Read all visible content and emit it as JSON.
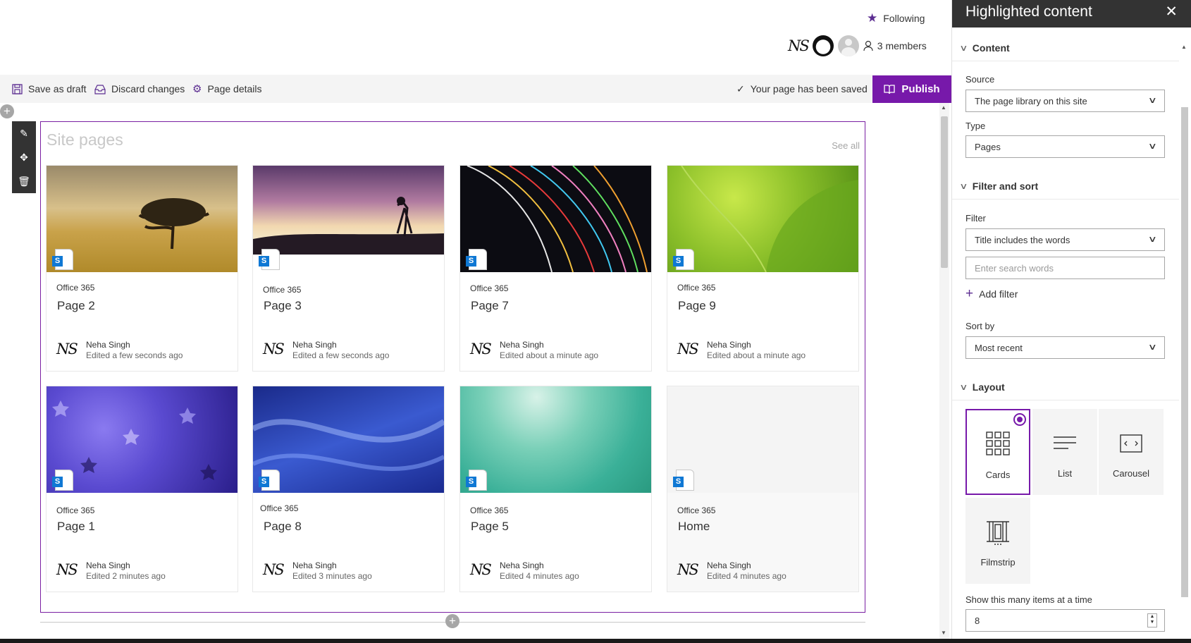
{
  "header": {
    "following_label": "Following",
    "members_label": "3 members",
    "signature": "NS"
  },
  "commandbar": {
    "save_draft": "Save as draft",
    "discard": "Discard changes",
    "page_details": "Page details",
    "saved_status": "Your page has been saved",
    "publish": "Publish"
  },
  "webpart": {
    "title": "Site pages",
    "see_all": "See all"
  },
  "cards": [
    {
      "site": "Office 365",
      "title": "Page 2",
      "author": "Neha Singh",
      "edited": "Edited a few seconds ago"
    },
    {
      "site": "Office 365",
      "title": "Page 3",
      "author": "Neha Singh",
      "edited": "Edited a few seconds ago"
    },
    {
      "site": "Office 365",
      "title": "Page 7",
      "author": "Neha Singh",
      "edited": "Edited about a minute ago"
    },
    {
      "site": "Office 365",
      "title": "Page 9",
      "author": "Neha Singh",
      "edited": "Edited about a minute ago"
    },
    {
      "site": "Office 365",
      "title": "Page 1",
      "author": "Neha Singh",
      "edited": "Edited 2 minutes ago"
    },
    {
      "site": "Office 365",
      "title": "Page 8",
      "author": "Neha Singh",
      "edited": "Edited 3 minutes ago"
    },
    {
      "site": "Office 365",
      "title": "Page 5",
      "author": "Neha Singh",
      "edited": "Edited 4 minutes ago"
    },
    {
      "site": "Office 365",
      "title": "Home",
      "author": "Neha Singh",
      "edited": "Edited 4 minutes ago"
    }
  ],
  "panel": {
    "title": "Highlighted content",
    "content_section": "Content",
    "source_label": "Source",
    "source_value": "The page library on this site",
    "type_label": "Type",
    "type_value": "Pages",
    "filter_section": "Filter and sort",
    "filter_label": "Filter",
    "filter_value": "Title includes the words",
    "search_placeholder": "Enter search words",
    "add_filter": "Add filter",
    "sort_label": "Sort by",
    "sort_value": "Most recent",
    "layout_section": "Layout",
    "layouts": [
      "Cards",
      "List",
      "Carousel",
      "Filmstrip"
    ],
    "selected_layout": "Cards",
    "items_label": "Show this many items at a time",
    "items_value": "8"
  },
  "colors": {
    "accent": "#7719aa",
    "command_icon": "#5c2d91",
    "panel_header": "#333333"
  }
}
